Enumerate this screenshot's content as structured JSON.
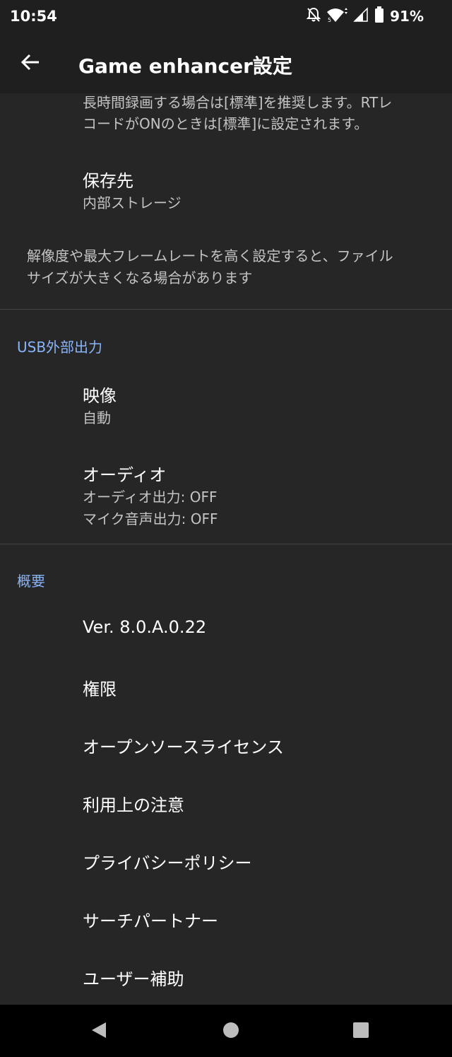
{
  "status_bar": {
    "time": "10:54",
    "battery_percent": "91%",
    "icons": [
      "bell-off-icon",
      "wifi-icon",
      "signal-icon",
      "battery-icon"
    ]
  },
  "app_bar": {
    "title": "Game enhancer設定",
    "back_icon": "arrow-left-icon"
  },
  "recording": {
    "quality_desc_line1": "長時間録画する場合は[標準]を推奨します。RTレ",
    "quality_desc_line2": "コードがONのときは[標準]に設定されます。",
    "save_location": {
      "title": "保存先",
      "value": "内部ストレージ"
    },
    "note_line1": "解像度や最大フレームレートを高く設定すると、ファイル",
    "note_line2": "サイズが大きくなる場合があります"
  },
  "usb_output": {
    "header": "USB外部出力",
    "video": {
      "title": "映像",
      "value": "自動"
    },
    "audio": {
      "title": "オーディオ",
      "audio_output": "オーディオ出力: OFF",
      "mic_output": "マイク音声出力: OFF"
    }
  },
  "about": {
    "header": "概要",
    "items": [
      "Ver. 8.0.A.0.22",
      "権限",
      "オープンソースライセンス",
      "利用上の注意",
      "プライバシーポリシー",
      "サーチパートナー",
      "ユーザー補助"
    ]
  },
  "nav_bar": {
    "icons": [
      "back-triangle-icon",
      "home-circle-icon",
      "recents-square-icon"
    ]
  },
  "colors": {
    "background": "#262626",
    "app_bar": "#1f1f1f",
    "accent": "#8ab4f8",
    "secondary_text": "#c4c4c4",
    "divider": "#444444"
  }
}
